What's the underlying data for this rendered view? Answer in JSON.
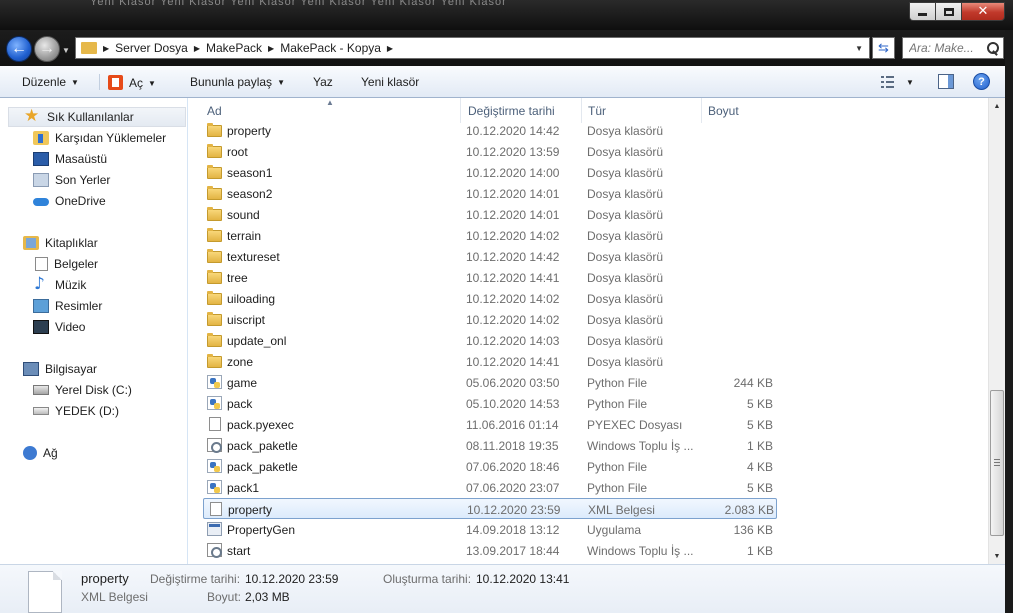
{
  "window": {
    "ghost_title": "Yeni Klasör   Yeni Klasör   Yeni Klasör   Yeni Klasör   Yeni Klasör   Yeni Klasör"
  },
  "address": {
    "crumbs": [
      "Server Dosya",
      "MakePack",
      "MakePack - Kopya"
    ]
  },
  "search": {
    "placeholder": "Ara: Make..."
  },
  "toolbar": {
    "organize": "Düzenle",
    "open": "Aç",
    "share": "Bununla paylaş",
    "print": "Yaz",
    "new_folder": "Yeni klasör"
  },
  "nav": {
    "favorites": "Sık Kullanılanlar",
    "downloads": "Karşıdan Yüklemeler",
    "desktop": "Masaüstü",
    "recent": "Son Yerler",
    "onedrive": "OneDrive",
    "libraries": "Kitaplıklar",
    "documents": "Belgeler",
    "music": "Müzik",
    "pictures": "Resimler",
    "videos": "Video",
    "computer": "Bilgisayar",
    "local_disk": "Yerel Disk (C:)",
    "yedek": "YEDEK (D:)",
    "network": "Ağ"
  },
  "columns": {
    "name": "Ad",
    "modified": "Değiştirme tarihi",
    "type": "Tür",
    "size": "Boyut"
  },
  "files": [
    {
      "name": "property",
      "date": "10.12.2020 14:42",
      "type": "Dosya klasörü",
      "size": "",
      "icon": "folder-icon"
    },
    {
      "name": "root",
      "date": "10.12.2020 13:59",
      "type": "Dosya klasörü",
      "size": "",
      "icon": "folder-icon"
    },
    {
      "name": "season1",
      "date": "10.12.2020 14:00",
      "type": "Dosya klasörü",
      "size": "",
      "icon": "folder-icon"
    },
    {
      "name": "season2",
      "date": "10.12.2020 14:01",
      "type": "Dosya klasörü",
      "size": "",
      "icon": "folder-icon"
    },
    {
      "name": "sound",
      "date": "10.12.2020 14:01",
      "type": "Dosya klasörü",
      "size": "",
      "icon": "folder-icon"
    },
    {
      "name": "terrain",
      "date": "10.12.2020 14:02",
      "type": "Dosya klasörü",
      "size": "",
      "icon": "folder-icon"
    },
    {
      "name": "textureset",
      "date": "10.12.2020 14:42",
      "type": "Dosya klasörü",
      "size": "",
      "icon": "folder-icon"
    },
    {
      "name": "tree",
      "date": "10.12.2020 14:41",
      "type": "Dosya klasörü",
      "size": "",
      "icon": "folder-icon"
    },
    {
      "name": "uiloading",
      "date": "10.12.2020 14:02",
      "type": "Dosya klasörü",
      "size": "",
      "icon": "folder-icon"
    },
    {
      "name": "uiscript",
      "date": "10.12.2020 14:02",
      "type": "Dosya klasörü",
      "size": "",
      "icon": "folder-icon"
    },
    {
      "name": "update_onl",
      "date": "10.12.2020 14:03",
      "type": "Dosya klasörü",
      "size": "",
      "icon": "folder-icon"
    },
    {
      "name": "zone",
      "date": "10.12.2020 14:41",
      "type": "Dosya klasörü",
      "size": "",
      "icon": "folder-icon"
    },
    {
      "name": "game",
      "date": "05.06.2020 03:50",
      "type": "Python File",
      "size": "244 KB",
      "icon": "python-file-icon"
    },
    {
      "name": "pack",
      "date": "05.10.2020 14:53",
      "type": "Python File",
      "size": "5 KB",
      "icon": "python-file-icon"
    },
    {
      "name": "pack.pyexec",
      "date": "11.06.2016 01:14",
      "type": "PYEXEC Dosyası",
      "size": "5 KB",
      "icon": "blank-file-icon"
    },
    {
      "name": "pack_paketle",
      "date": "08.11.2018 19:35",
      "type": "Windows Toplu İş ...",
      "size": "1 KB",
      "icon": "batch-file-icon"
    },
    {
      "name": "pack_paketle",
      "date": "07.06.2020 18:46",
      "type": "Python File",
      "size": "4 KB",
      "icon": "python-file-icon"
    },
    {
      "name": "pack1",
      "date": "07.06.2020 23:07",
      "type": "Python File",
      "size": "5 KB",
      "icon": "python-file-icon"
    },
    {
      "name": "property",
      "date": "10.12.2020 23:59",
      "type": "XML Belgesi",
      "size": "2.083 KB",
      "icon": "blank-file-icon",
      "selected": true
    },
    {
      "name": "PropertyGen",
      "date": "14.09.2018 13:12",
      "type": "Uygulama",
      "size": "136 KB",
      "icon": "exe-file-icon"
    },
    {
      "name": "start",
      "date": "13.09.2017 18:44",
      "type": "Windows Toplu İş ...",
      "size": "1 KB",
      "icon": "batch-file-icon"
    }
  ],
  "details": {
    "name": "property",
    "type": "XML Belgesi",
    "modified_label": "Değiştirme tarihi:",
    "modified_value": "10.12.2020 23:59",
    "size_label": "Boyut:",
    "size_value": "2,03 MB",
    "created_label": "Oluşturma tarihi:",
    "created_value": "10.12.2020 13:41"
  }
}
